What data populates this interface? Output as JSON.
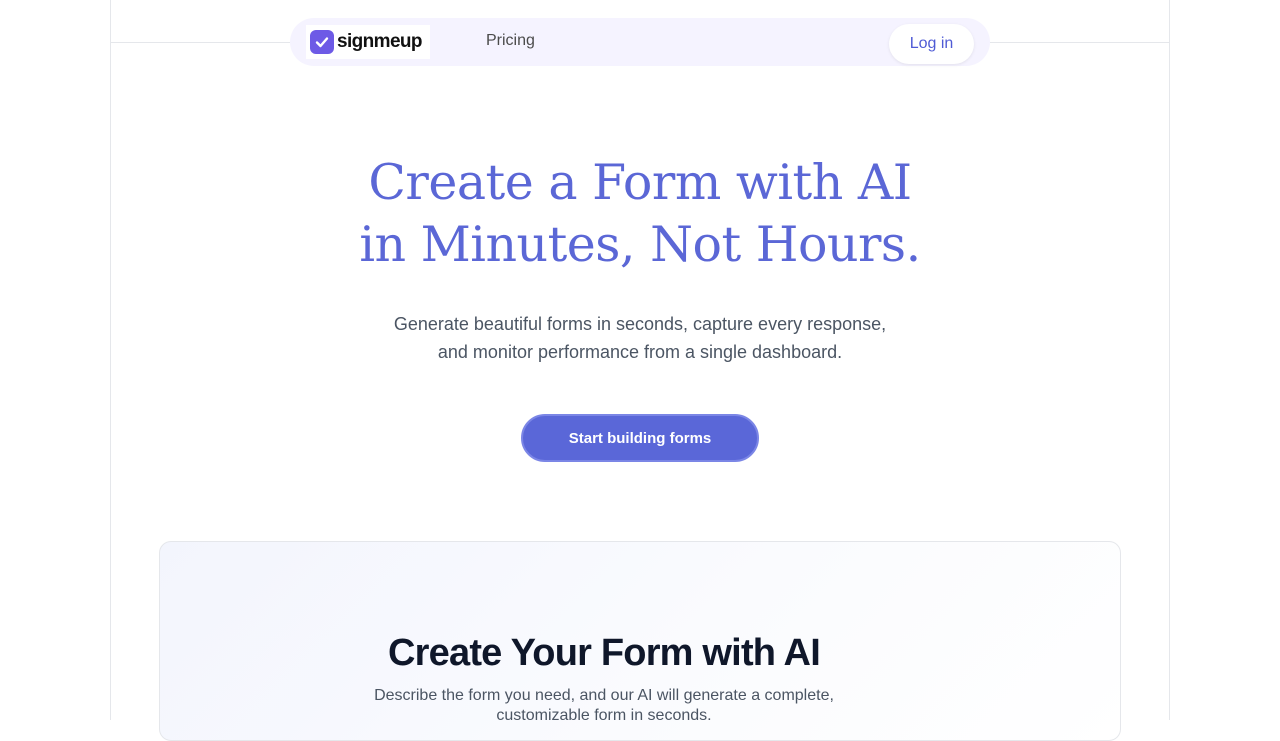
{
  "navbar": {
    "logo_text": "signmeup",
    "logo_icon": "check-square-icon",
    "links": [
      {
        "label": "Pricing"
      }
    ],
    "login_label": "Log in"
  },
  "hero": {
    "title_line1": "Create a Form with AI",
    "title_line2": "in Minutes, Not Hours.",
    "subtitle_line1": "Generate beautiful forms in seconds, capture every response,",
    "subtitle_line2": "and monitor performance from a single dashboard.",
    "cta_label": "Start building forms"
  },
  "feature_card": {
    "title": "Create Your Form with AI",
    "desc_line1": "Describe the form you need, and our AI will generate a complete,",
    "desc_line2": "customizable form in seconds."
  },
  "colors": {
    "accent": "#5a67d8",
    "title": "#5b67d6",
    "nav_bg": "#f5f3ff",
    "logo_mark": "#6d5ae6"
  }
}
